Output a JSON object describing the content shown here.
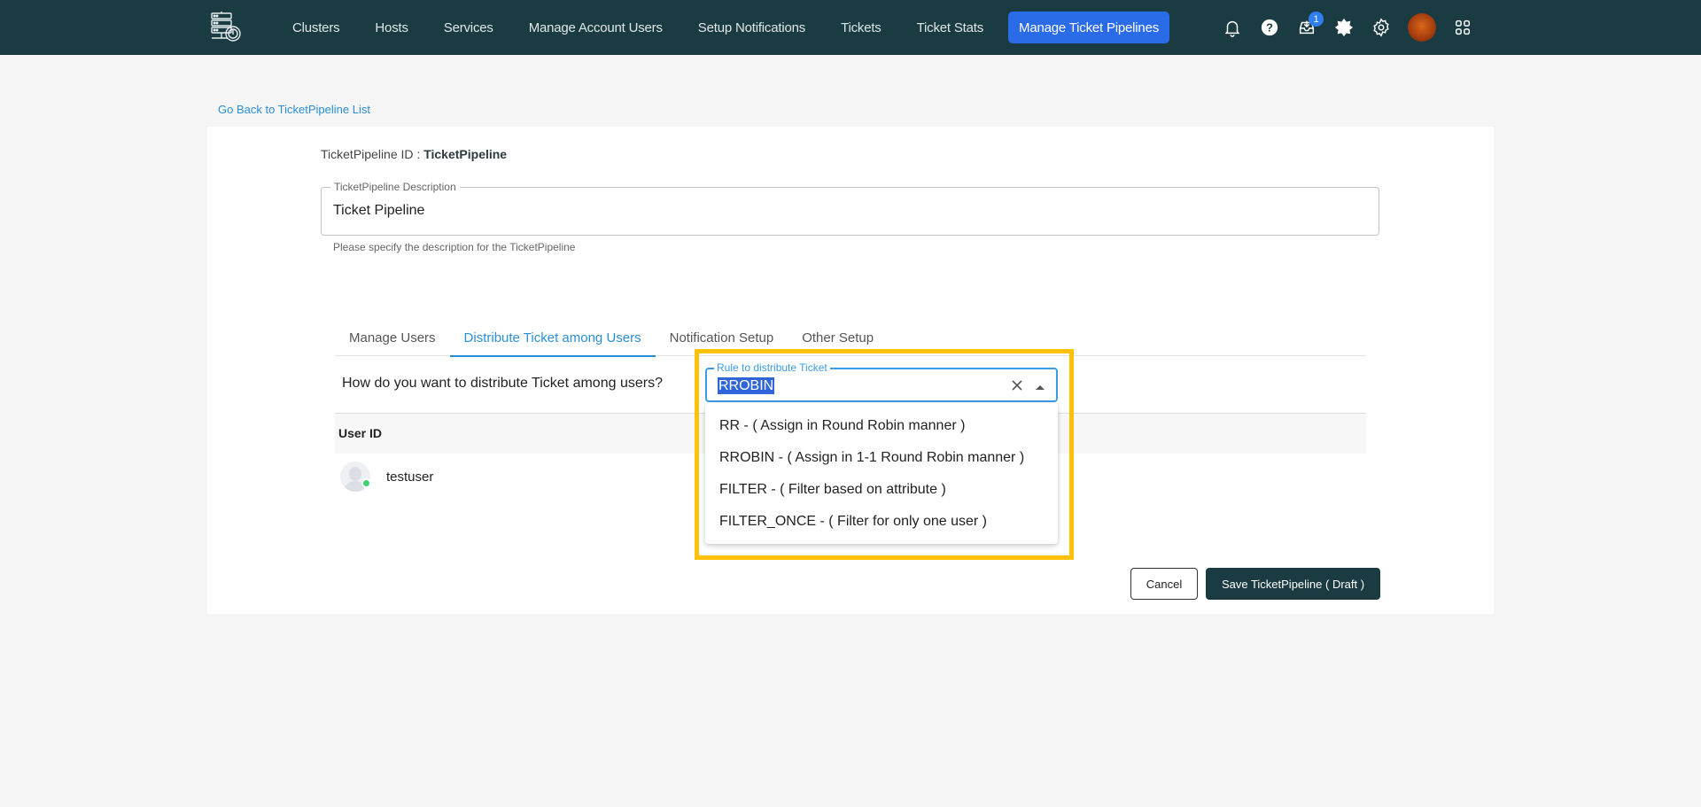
{
  "nav": {
    "links": [
      {
        "label": "Clusters"
      },
      {
        "label": "Hosts"
      },
      {
        "label": "Services"
      },
      {
        "label": "Manage Account Users"
      },
      {
        "label": "Setup Notifications"
      },
      {
        "label": "Tickets"
      },
      {
        "label": "Ticket Stats"
      },
      {
        "label": "Manage Ticket Pipelines",
        "active": true
      }
    ],
    "icons": [
      "bell-icon",
      "help-icon",
      "inbox-icon",
      "theme-toggle-icon",
      "settings-icon",
      "user-avatar",
      "apps-grid-icon"
    ],
    "inbox_badge": "1",
    "colors": {
      "background": "#1b3b42",
      "active": "#2a6be8"
    }
  },
  "back_link": "Go Back to TicketPipeline List",
  "pipeline": {
    "id_label": "TicketPipeline ID : ",
    "id_value": "TicketPipeline",
    "description_label": "TicketPipeline Description",
    "description_value": "Ticket Pipeline",
    "description_help": "Please specify the description for the TicketPipeline"
  },
  "tabs": [
    {
      "label": "Manage Users"
    },
    {
      "label": "Distribute Ticket among Users",
      "active": true
    },
    {
      "label": "Notification Setup"
    },
    {
      "label": "Other Setup"
    }
  ],
  "distribute": {
    "question": "How do you want to distribute Ticket among users?",
    "rule_label": "Rule to distribute Ticket",
    "rule_value": "RROBIN",
    "options": [
      "RR - ( Assign in Round Robin manner )",
      "RROBIN - ( Assign in 1-1 Round Robin manner )",
      "FILTER - ( Filter based on attribute )",
      "FILTER_ONCE - ( Filter for only one user )"
    ]
  },
  "users_table": {
    "header": "User ID",
    "rows": [
      {
        "user": "testuser",
        "status": "online"
      }
    ]
  },
  "actions": {
    "cancel": "Cancel",
    "save": "Save TicketPipeline ( Draft )"
  },
  "highlight_color": "#ffc107"
}
